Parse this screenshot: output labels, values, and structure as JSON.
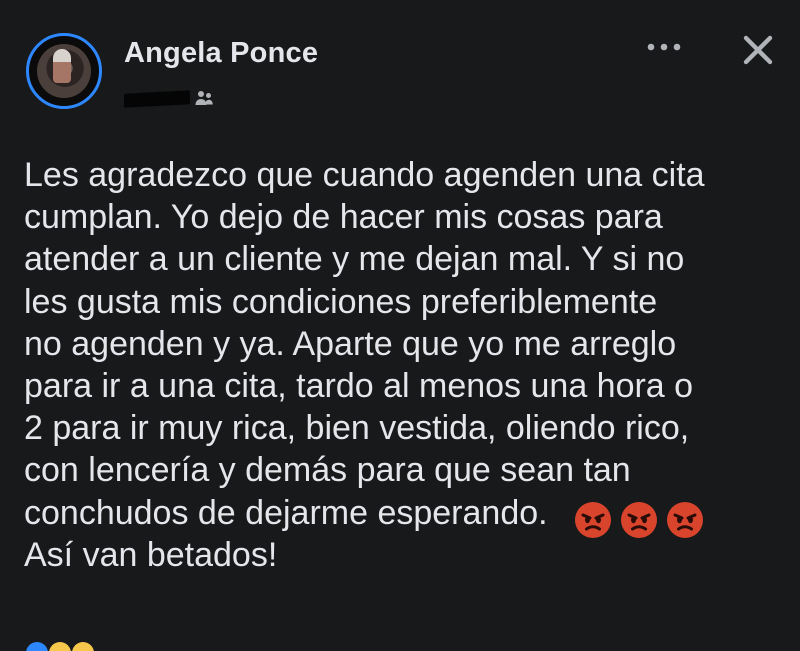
{
  "post": {
    "author_name": "Angela Ponce",
    "timestamp": "",
    "text_lines": [
      "Les agradezco que cuando agenden una cita",
      "cumplan. Yo dejo de hacer mis cosas para",
      "atender a un cliente y me dejan mal. Y si no",
      "les gusta mis condiciones preferiblemente",
      "no agenden y ya. Aparte que yo me arreglo",
      "para ir a una cita, tardo al menos una hora o",
      "2 para ir muy rica, bien vestida, oliendo rico,",
      "con lencería y demás para que sean tan",
      "conchudos de dejarme esperando.",
      "Así van betados!"
    ],
    "emojis": [
      "angry-face",
      "angry-face",
      "angry-face"
    ]
  },
  "icons": {
    "audience": "friends-icon",
    "more": "more-options-icon",
    "close": "close-icon"
  },
  "colors": {
    "background": "#18191a",
    "text": "#e4e6eb",
    "avatar_ring": "#2d88ff",
    "emoji_red": "#d8442c"
  }
}
